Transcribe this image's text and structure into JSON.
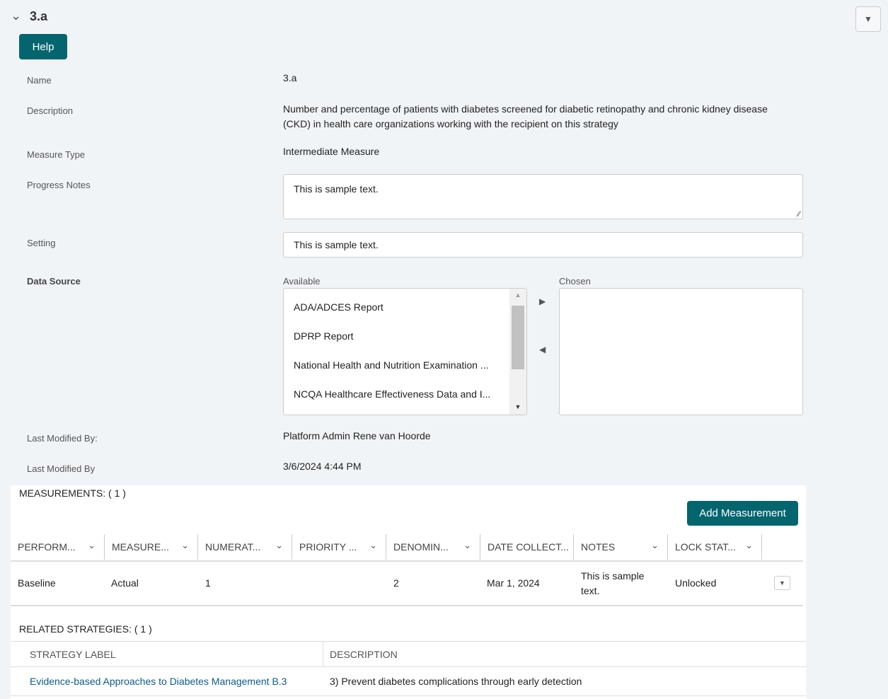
{
  "header": {
    "title": "3.a",
    "help_label": "Help"
  },
  "fields": {
    "name_label": "Name",
    "name_value": "3.a",
    "description_label": "Description",
    "description_value": "Number and percentage of patients with diabetes screened for diabetic retinopathy and chronic kidney disease (CKD) in health care organizations working with the recipient on this strategy",
    "measure_type_label": "Measure Type",
    "measure_type_value": "Intermediate Measure",
    "progress_notes_label": "Progress Notes",
    "progress_notes_value": "This is sample text.",
    "setting_label": "Setting",
    "setting_value": "This is sample text.",
    "data_source_label": "Data Source",
    "available_label": "Available",
    "chosen_label": "Chosen",
    "available_items": [
      "ADA/ADCES Report",
      "DPRP Report",
      "National Health and Nutrition Examination ...",
      "NCQA Healthcare Effectiveness Data and I..."
    ],
    "last_modified_by_label": "Last Modified By:",
    "last_modified_by_value": "Platform Admin Rene van Hoorde",
    "last_modified_label": "Last Modified By",
    "last_modified_value": "3/6/2024 4:44 PM"
  },
  "measurements": {
    "title": "MEASUREMENTS: ( 1 )",
    "add_label": "Add Measurement",
    "columns": [
      "PERFORM...",
      "MEASURE...",
      "NUMERAT...",
      "PRIORITY ...",
      "DENOMIN...",
      "DATE COLLECT...",
      "NOTES",
      "LOCK STAT..."
    ],
    "rows": [
      [
        "Baseline",
        "Actual",
        "1",
        "",
        "2",
        "Mar 1, 2024",
        "This is sample text.",
        "Unlocked"
      ]
    ]
  },
  "related": {
    "title": "RELATED STRATEGIES: ( 1 )",
    "columns": [
      "STRATEGY LABEL",
      "DESCRIPTION"
    ],
    "rows": [
      [
        "Evidence-based Approaches to Diabetes Management B.3",
        "3) Prevent diabetes complications through early detection"
      ]
    ]
  },
  "colors": {
    "accent": "#04656f",
    "link": "#0b5c8a"
  }
}
